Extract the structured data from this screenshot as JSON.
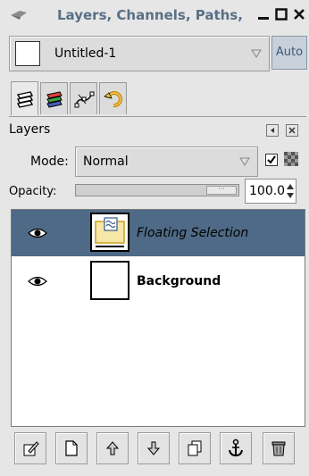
{
  "window": {
    "title": "Layers, Channels, Paths,",
    "buttons": {
      "minimize_icon": "minimize-icon",
      "maximize_icon": "maximize-icon",
      "close_icon": "close-icon"
    }
  },
  "image_selector": {
    "selected": "Untitled-1",
    "auto_label": "Auto"
  },
  "tabs": [
    {
      "icon": "layers-icon",
      "active": true
    },
    {
      "icon": "channels-icon",
      "active": false
    },
    {
      "icon": "paths-icon",
      "active": false
    },
    {
      "icon": "undo-history-icon",
      "active": false
    }
  ],
  "layers_panel": {
    "title": "Layers",
    "mode_label": "Mode:",
    "mode_value": "Normal",
    "opacity_label": "Opacity:",
    "opacity_value": "100.0",
    "opacity_fraction": 1.0,
    "keep_transparency_checked": true
  },
  "layers": [
    {
      "name": "Floating Selection",
      "visible": true,
      "selected": true
    },
    {
      "name": "Background",
      "visible": true,
      "selected": false
    }
  ],
  "bottom_buttons": [
    "edit-layer-icon",
    "new-layer-icon",
    "raise-layer-icon",
    "lower-layer-icon",
    "duplicate-layer-icon",
    "anchor-layer-icon",
    "delete-layer-icon"
  ],
  "colors": {
    "selection": "#4e6a86",
    "title": "#596f86",
    "auto_button": "#c8d0da"
  }
}
